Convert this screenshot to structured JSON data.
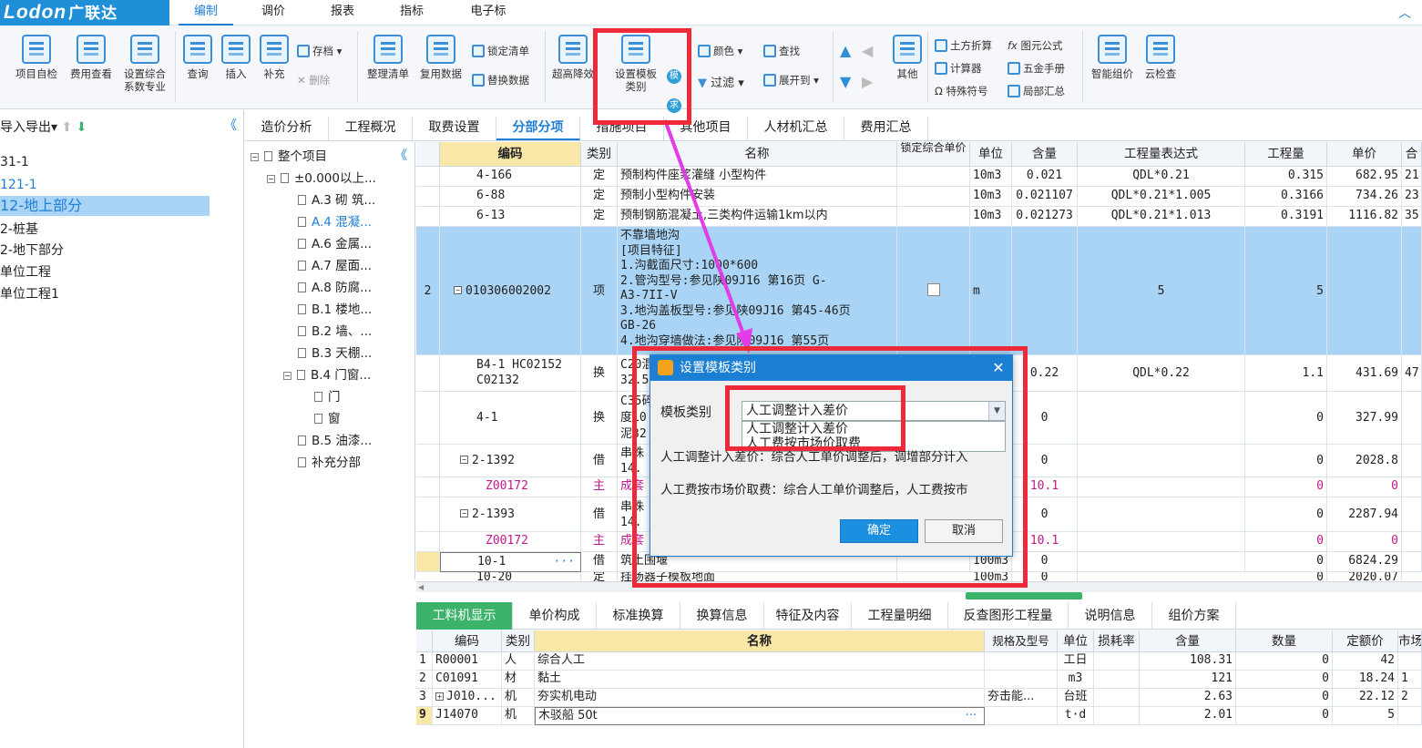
{
  "app": {
    "logo_text": "Lodon",
    "logo_cn": "广联达"
  },
  "menu_tabs": [
    "编制",
    "调价",
    "报表",
    "指标",
    "电子标"
  ],
  "ribbon": {
    "b1": "项目自检",
    "b2": "费用查看",
    "b3a": "设置综合",
    "b3b": "系数专业",
    "b4": "查询",
    "b5": "插入",
    "b6": "补充",
    "b7": "存档",
    "b8": "删除",
    "b9": "整理清单",
    "b10": "复用数据",
    "b11": "锁定清单",
    "b12": "替换数据",
    "b13": "超高降效",
    "b14a": "设置模板",
    "b14b": "类别",
    "b15": "颜色",
    "b16": "查找",
    "b17": "过滤",
    "b18": "展开到",
    "b19": "其他",
    "b20": "土方折算",
    "b21": "图元公式",
    "b22": "计算器",
    "b23": "五金手册",
    "b24": "特殊符号",
    "b25": "局部汇总",
    "b26": "智能组价",
    "b27": "云检查",
    "m": "模",
    "q": "求"
  },
  "left": {
    "header": "导入导出",
    "items": [
      "31-1",
      "121-1",
      "12-地上部分",
      "2-桩基",
      "2-地下部分",
      "单位工程",
      "单位工程1"
    ]
  },
  "tabs": [
    "造价分析",
    "工程概况",
    "取费设置",
    "分部分项",
    "措施项目",
    "其他项目",
    "人材机汇总",
    "费用汇总"
  ],
  "tree": [
    "整个项目",
    "±0.000以上...",
    "A.3 砌 筑...",
    "A.4 混凝...",
    "A.6 金属...",
    "A.7 屋面...",
    "A.8 防腐...",
    "B.1 楼地...",
    "B.2 墙、...",
    "B.3 天棚...",
    "B.4 门窗...",
    "门",
    "窗",
    "B.5 油漆...",
    "补充分部"
  ],
  "grid_headers": [
    "编码",
    "类别",
    "名称",
    "锁定综合单价",
    "单位",
    "含量",
    "工程量表达式",
    "工程量",
    "单价",
    "合"
  ],
  "rows": [
    {
      "num": "",
      "code": "4-166",
      "type": "定",
      "name": "预制构件座浆灌缝 小型构件",
      "unit": "10m3",
      "qty": "0.021",
      "expr": "QDL*0.21",
      "amount": "0.315",
      "price": "682.95",
      "total": "21"
    },
    {
      "num": "",
      "code": "6-88",
      "type": "定",
      "name": "预制小型构件安装",
      "unit": "10m3",
      "qty": "0.021107",
      "expr": "QDL*0.21*1.005",
      "amount": "0.3166",
      "price": "734.26",
      "total": "23"
    },
    {
      "num": "",
      "code": "6-13",
      "type": "定",
      "name": "预制钢筋混凝土,三类构件运输1km以内",
      "unit": "10m3",
      "qty": "0.021273",
      "expr": "QDL*0.21*1.013",
      "amount": "0.3191",
      "price": "1116.82",
      "total": "35"
    }
  ],
  "sel_row": {
    "num": "2",
    "code": "010306002002",
    "type": "项",
    "unit": "m",
    "expr": "5",
    "amount": "5",
    "name_lines": [
      "不靠墙地沟",
      "[项目特征]",
      "1.沟截面尺寸:1000*600",
      "2.管沟型号:参见陕09J16 第16页 G-",
      "A3-7II-V",
      "3.地沟盖板型号:参见陕09J16  第45-46页",
      "GB-26",
      "4.地沟穿墙做法:参见陕09J16 第55页"
    ]
  },
  "rows2": [
    {
      "code": "B4-1 HC02152",
      "code2": "C02132",
      "type": "换",
      "name": "C20混",
      "name2": "32.5",
      "qty": "0.22",
      "expr": "QDL*0.22",
      "amount": "1.1",
      "price": "431.69",
      "total": "47"
    },
    {
      "code": "4-1",
      "type": "换",
      "name": "C35碎",
      "name2": "度10",
      "name3": "泥32",
      "qty": "0",
      "amount": "0",
      "price": "327.99"
    },
    {
      "code": "2-1392",
      "type": "借",
      "name": "串珠",
      "name2": "14.",
      "qty": "0",
      "amount": "0",
      "price": "2028.8"
    },
    {
      "code": "Z00172",
      "type": "主",
      "name": "成套",
      "qty": "10.1",
      "amount": "0",
      "price": "0"
    },
    {
      "code": "2-1393",
      "type": "借",
      "name": "串珠",
      "name2": "14.",
      "qty": "0",
      "amount": "0",
      "price": "2287.94"
    },
    {
      "code": "Z00172",
      "type": "主",
      "name": "成套",
      "qty": "10.1",
      "amount": "0",
      "price": "0"
    },
    {
      "code": "10-1",
      "type": "借",
      "name": "筑土围堰",
      "unit": "100m3",
      "qty": "0",
      "amount": "0",
      "price": "6824.29"
    },
    {
      "code": "10-20",
      "type": "定",
      "name": "挂场器子模板地面",
      "unit": "100m3",
      "qty": "0",
      "amount": "0",
      "price": "2020.07"
    }
  ],
  "lower_tabs": [
    "工料机显示",
    "单价构成",
    "标准换算",
    "换算信息",
    "特征及内容",
    "工程量明细",
    "反查图形工程量",
    "说明信息",
    "组价方案"
  ],
  "lower_headers": [
    "编码",
    "类别",
    "名称",
    "规格及型号",
    "单位",
    "损耗率",
    "含量",
    "数量",
    "定额价",
    "市场"
  ],
  "lower_rows": [
    {
      "n": "1",
      "code": "R00001",
      "type": "人",
      "name": "综合人工",
      "spec": "",
      "unit": "工日",
      "loss": "",
      "qty": "108.31",
      "num": "0",
      "price": "42",
      "mkt": ""
    },
    {
      "n": "2",
      "code": "C01091",
      "type": "材",
      "name": "黏土",
      "spec": "",
      "unit": "m3",
      "loss": "",
      "qty": "121",
      "num": "0",
      "price": "18.24",
      "mkt": "1"
    },
    {
      "n": "3",
      "code": "J010...",
      "type": "机",
      "name": "夯实机电动",
      "spec": "夯击能...",
      "unit": "台班",
      "loss": "",
      "qty": "2.63",
      "num": "0",
      "price": "22.12",
      "mkt": "2"
    },
    {
      "n": "9",
      "code": "J14070",
      "type": "机",
      "name": "木驳船 50t",
      "spec": "",
      "unit": "t·d",
      "loss": "",
      "qty": "2.01",
      "num": "0",
      "price": "5",
      "mkt": ""
    }
  ],
  "dialog": {
    "title": "设置模板类别",
    "label": "模板类别",
    "selected": "人工调整计入差价",
    "options": [
      "人工调整计入差价",
      "人工费按市场价取费"
    ],
    "desc1": "人工调整计入差价：综合人工单价调整后，调增部分计入",
    "desc2": "人工费按市场价取费：综合人工单价调整后，人工费按市",
    "ok": "确定",
    "cancel": "取消"
  },
  "colors": {
    "accent": "#1f7fd6",
    "selection": "#a9d4f5",
    "annotation": "#ee2a3a",
    "arrow": "#e23ce6",
    "green_tab": "#3cb36a"
  }
}
